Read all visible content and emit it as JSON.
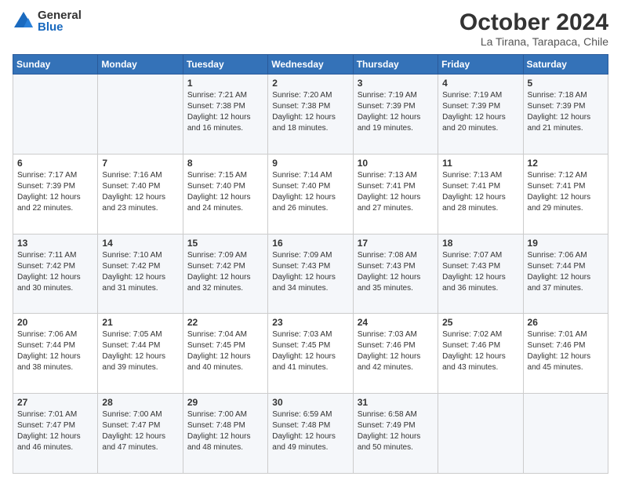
{
  "logo": {
    "general": "General",
    "blue": "Blue"
  },
  "title": "October 2024",
  "subtitle": "La Tirana, Tarapaca, Chile",
  "days_of_week": [
    "Sunday",
    "Monday",
    "Tuesday",
    "Wednesday",
    "Thursday",
    "Friday",
    "Saturday"
  ],
  "weeks": [
    [
      {
        "day": "",
        "info": ""
      },
      {
        "day": "",
        "info": ""
      },
      {
        "day": "1",
        "info": "Sunrise: 7:21 AM\nSunset: 7:38 PM\nDaylight: 12 hours and 16 minutes."
      },
      {
        "day": "2",
        "info": "Sunrise: 7:20 AM\nSunset: 7:38 PM\nDaylight: 12 hours and 18 minutes."
      },
      {
        "day": "3",
        "info": "Sunrise: 7:19 AM\nSunset: 7:39 PM\nDaylight: 12 hours and 19 minutes."
      },
      {
        "day": "4",
        "info": "Sunrise: 7:19 AM\nSunset: 7:39 PM\nDaylight: 12 hours and 20 minutes."
      },
      {
        "day": "5",
        "info": "Sunrise: 7:18 AM\nSunset: 7:39 PM\nDaylight: 12 hours and 21 minutes."
      }
    ],
    [
      {
        "day": "6",
        "info": "Sunrise: 7:17 AM\nSunset: 7:39 PM\nDaylight: 12 hours and 22 minutes."
      },
      {
        "day": "7",
        "info": "Sunrise: 7:16 AM\nSunset: 7:40 PM\nDaylight: 12 hours and 23 minutes."
      },
      {
        "day": "8",
        "info": "Sunrise: 7:15 AM\nSunset: 7:40 PM\nDaylight: 12 hours and 24 minutes."
      },
      {
        "day": "9",
        "info": "Sunrise: 7:14 AM\nSunset: 7:40 PM\nDaylight: 12 hours and 26 minutes."
      },
      {
        "day": "10",
        "info": "Sunrise: 7:13 AM\nSunset: 7:41 PM\nDaylight: 12 hours and 27 minutes."
      },
      {
        "day": "11",
        "info": "Sunrise: 7:13 AM\nSunset: 7:41 PM\nDaylight: 12 hours and 28 minutes."
      },
      {
        "day": "12",
        "info": "Sunrise: 7:12 AM\nSunset: 7:41 PM\nDaylight: 12 hours and 29 minutes."
      }
    ],
    [
      {
        "day": "13",
        "info": "Sunrise: 7:11 AM\nSunset: 7:42 PM\nDaylight: 12 hours and 30 minutes."
      },
      {
        "day": "14",
        "info": "Sunrise: 7:10 AM\nSunset: 7:42 PM\nDaylight: 12 hours and 31 minutes."
      },
      {
        "day": "15",
        "info": "Sunrise: 7:09 AM\nSunset: 7:42 PM\nDaylight: 12 hours and 32 minutes."
      },
      {
        "day": "16",
        "info": "Sunrise: 7:09 AM\nSunset: 7:43 PM\nDaylight: 12 hours and 34 minutes."
      },
      {
        "day": "17",
        "info": "Sunrise: 7:08 AM\nSunset: 7:43 PM\nDaylight: 12 hours and 35 minutes."
      },
      {
        "day": "18",
        "info": "Sunrise: 7:07 AM\nSunset: 7:43 PM\nDaylight: 12 hours and 36 minutes."
      },
      {
        "day": "19",
        "info": "Sunrise: 7:06 AM\nSunset: 7:44 PM\nDaylight: 12 hours and 37 minutes."
      }
    ],
    [
      {
        "day": "20",
        "info": "Sunrise: 7:06 AM\nSunset: 7:44 PM\nDaylight: 12 hours and 38 minutes."
      },
      {
        "day": "21",
        "info": "Sunrise: 7:05 AM\nSunset: 7:44 PM\nDaylight: 12 hours and 39 minutes."
      },
      {
        "day": "22",
        "info": "Sunrise: 7:04 AM\nSunset: 7:45 PM\nDaylight: 12 hours and 40 minutes."
      },
      {
        "day": "23",
        "info": "Sunrise: 7:03 AM\nSunset: 7:45 PM\nDaylight: 12 hours and 41 minutes."
      },
      {
        "day": "24",
        "info": "Sunrise: 7:03 AM\nSunset: 7:46 PM\nDaylight: 12 hours and 42 minutes."
      },
      {
        "day": "25",
        "info": "Sunrise: 7:02 AM\nSunset: 7:46 PM\nDaylight: 12 hours and 43 minutes."
      },
      {
        "day": "26",
        "info": "Sunrise: 7:01 AM\nSunset: 7:46 PM\nDaylight: 12 hours and 45 minutes."
      }
    ],
    [
      {
        "day": "27",
        "info": "Sunrise: 7:01 AM\nSunset: 7:47 PM\nDaylight: 12 hours and 46 minutes."
      },
      {
        "day": "28",
        "info": "Sunrise: 7:00 AM\nSunset: 7:47 PM\nDaylight: 12 hours and 47 minutes."
      },
      {
        "day": "29",
        "info": "Sunrise: 7:00 AM\nSunset: 7:48 PM\nDaylight: 12 hours and 48 minutes."
      },
      {
        "day": "30",
        "info": "Sunrise: 6:59 AM\nSunset: 7:48 PM\nDaylight: 12 hours and 49 minutes."
      },
      {
        "day": "31",
        "info": "Sunrise: 6:58 AM\nSunset: 7:49 PM\nDaylight: 12 hours and 50 minutes."
      },
      {
        "day": "",
        "info": ""
      },
      {
        "day": "",
        "info": ""
      }
    ]
  ]
}
